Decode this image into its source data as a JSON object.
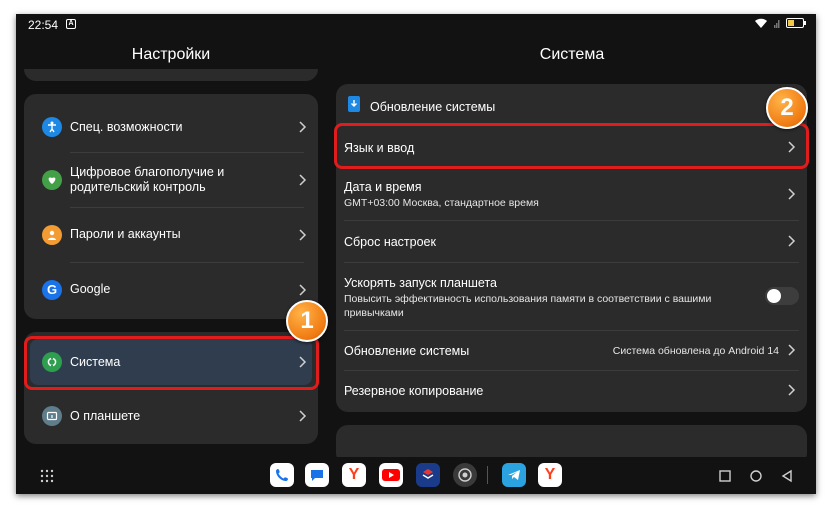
{
  "status": {
    "time": "22:54",
    "notif_letter": "A"
  },
  "left": {
    "title": "Настройки",
    "items": [
      {
        "label": "Спец. возможности",
        "icon": "accessibility-icon",
        "color": "#1e88e5"
      },
      {
        "label": "Цифровое благополучие и родительский контроль",
        "icon": "wellbeing-icon",
        "color": "#43a047"
      },
      {
        "label": "Пароли и аккаунты",
        "icon": "accounts-icon",
        "color": "#f39c33"
      },
      {
        "label": "Google",
        "icon": "google-icon",
        "color": "#1a73e8"
      },
      {
        "label": "Система",
        "icon": "system-icon",
        "color": "#2e9e4f"
      },
      {
        "label": "О планшете",
        "icon": "tablet-info-icon",
        "color": "#607d8b"
      }
    ]
  },
  "right": {
    "title": "Система",
    "items": {
      "update_top": "Обновление системы",
      "language": "Язык и ввод",
      "datetime": "Дата и время",
      "datetime_sub": "GMT+03:00 Москва, стандартное время",
      "reset": "Сброс настроек",
      "boost": "Ускорять запуск планшета",
      "boost_sub": "Повысить эффективность использования памяти в соответствии с вашими привычками",
      "update": "Обновление системы",
      "update_value": "Система обновлена до Android 14",
      "backup": "Резервное копирование"
    },
    "boost_enabled": false
  },
  "badges": {
    "one": "1",
    "two": "2"
  },
  "dock": [
    "phone-app-icon",
    "messages-app-icon",
    "yandex-app-icon",
    "youtube-app-icon",
    "gosuslugi-app-icon",
    "camera-app-icon",
    "telegram-app-icon",
    "yandex-browser-app-icon"
  ],
  "colors": {
    "highlight": "#e01c1c",
    "badge": "#f07a12",
    "card": "#2b2b2b",
    "selected": "#2f3d4f"
  }
}
